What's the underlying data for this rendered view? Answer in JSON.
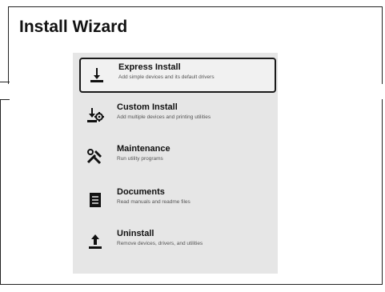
{
  "window": {
    "title": "Install Wizard"
  },
  "menu": {
    "items": [
      {
        "label": "Express Install",
        "description": "Add simple devices and its default drivers",
        "icon": "download-icon",
        "selected": true
      },
      {
        "label": "Custom Install",
        "description": "Add multiple devices and printing utilities",
        "icon": "custom-install-icon",
        "selected": false
      },
      {
        "label": "Maintenance",
        "description": "Run utility programs",
        "icon": "tools-icon",
        "selected": false
      },
      {
        "label": "Documents",
        "description": "Read manuals and readme files",
        "icon": "document-icon",
        "selected": false
      },
      {
        "label": "Uninstall",
        "description": "Remove devices, drivers, and utilities",
        "icon": "upload-icon",
        "selected": false
      }
    ]
  },
  "colors": {
    "panel": "#e6e6e6",
    "selection_border": "#1a1a1a",
    "text": "#111111"
  }
}
